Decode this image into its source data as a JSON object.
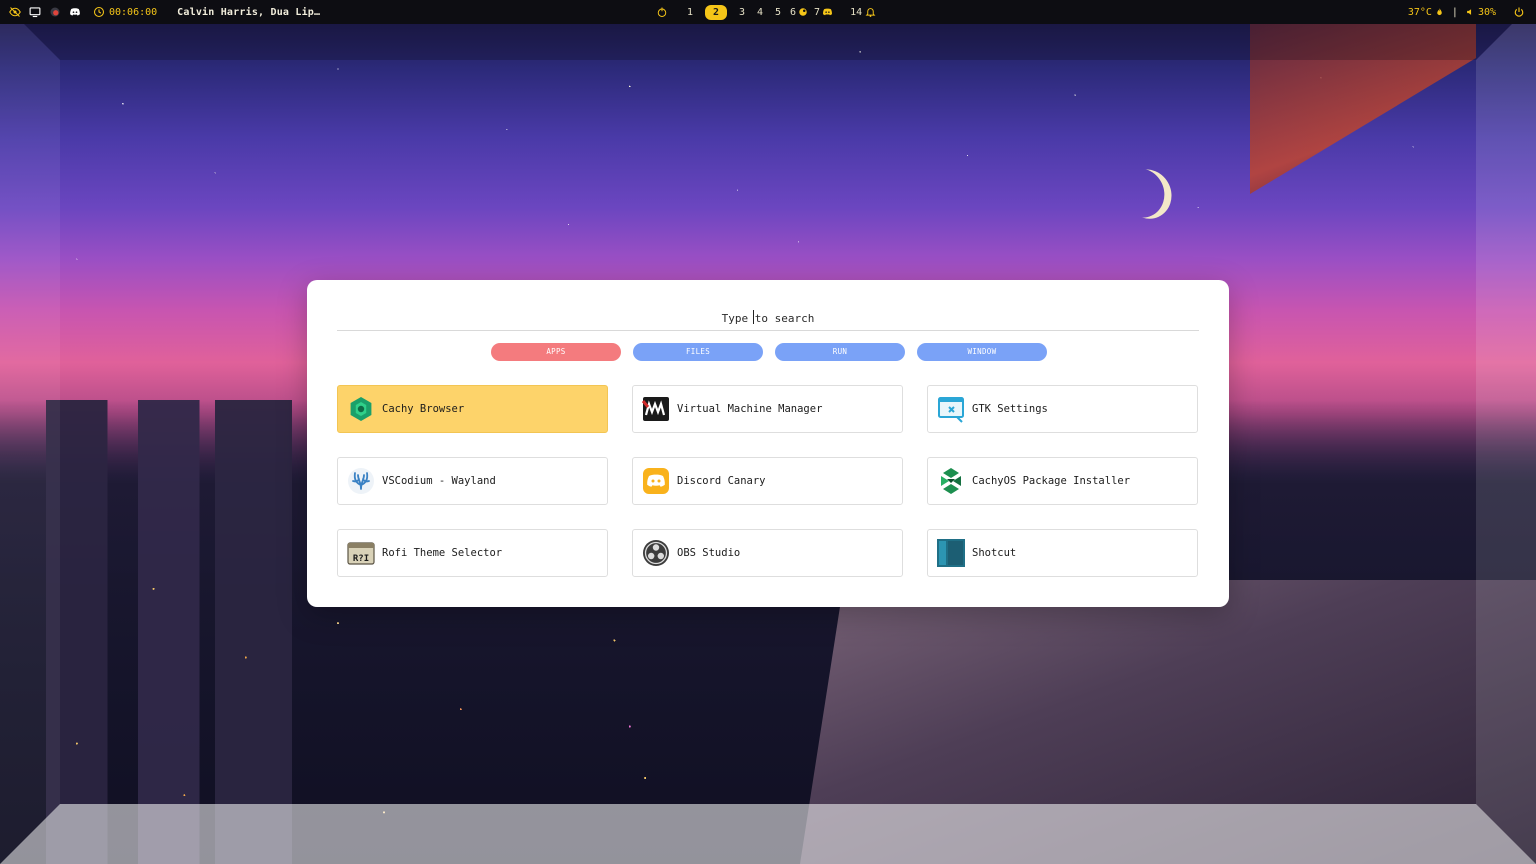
{
  "topbar": {
    "icons": [
      "eye-slash-icon",
      "monitor-icon",
      "record-icon",
      "discord-icon",
      "clock-icon"
    ],
    "timer": "00:06:00",
    "media_title": "Calvin Harris, Dua Lip…",
    "workspace_icon": "power-circle-icon",
    "workspaces": [
      {
        "label": "1",
        "active": false
      },
      {
        "label": "2",
        "active": true
      },
      {
        "label": "3",
        "active": false
      },
      {
        "label": "4",
        "active": false
      },
      {
        "label": "5",
        "active": false
      },
      {
        "label": "6",
        "active": false,
        "icon": "steam-icon"
      },
      {
        "label": "7",
        "active": false,
        "icon": "discord-icon"
      }
    ],
    "notifications": "14",
    "temperature": "37°C",
    "volume": "30%",
    "separator": "|"
  },
  "launcher": {
    "search_placeholder": "Type to search",
    "search_value": "",
    "modes": [
      {
        "label": "APPS",
        "active": true
      },
      {
        "label": "FILES",
        "active": false
      },
      {
        "label": "RUN",
        "active": false
      },
      {
        "label": "WINDOW",
        "active": false
      }
    ],
    "apps": [
      {
        "label": "Cachy Browser",
        "icon": "cachy-browser-icon",
        "selected": true
      },
      {
        "label": "Virtual Machine Manager",
        "icon": "virt-manager-icon",
        "selected": false
      },
      {
        "label": "GTK Settings",
        "icon": "gtk-settings-icon",
        "selected": false
      },
      {
        "label": "VSCodium - Wayland",
        "icon": "vscodium-icon",
        "selected": false
      },
      {
        "label": "Discord Canary",
        "icon": "discord-canary-icon",
        "selected": false
      },
      {
        "label": "CachyOS Package Installer",
        "icon": "cachyos-package-installer-icon",
        "selected": false
      },
      {
        "label": "Rofi Theme Selector",
        "icon": "rofi-theme-selector-icon",
        "selected": false
      },
      {
        "label": "OBS Studio",
        "icon": "obs-studio-icon",
        "selected": false
      },
      {
        "label": "Shotcut",
        "icon": "shotcut-icon",
        "selected": false
      }
    ]
  },
  "colors": {
    "accent_yellow": "#f5c518",
    "selected_app": "#fdd36a",
    "mode_active": "#f47b7e",
    "mode_inactive": "#7aa2f7",
    "topbar_bg": "#0d0d12"
  }
}
